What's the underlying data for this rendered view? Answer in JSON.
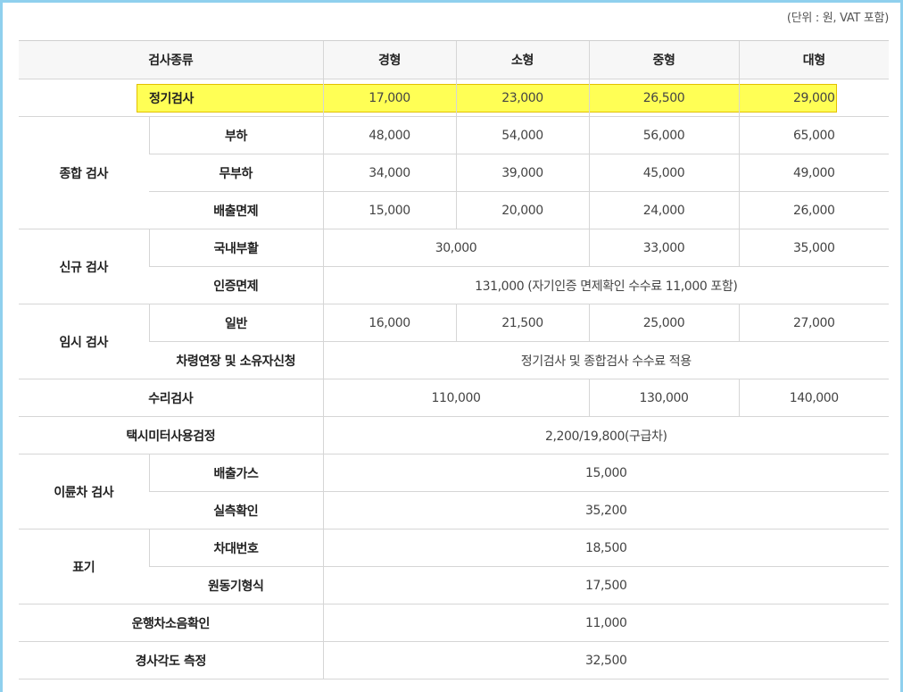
{
  "unit_note": "(단위 : 원, VAT 포함)",
  "header": {
    "type": "검사종류",
    "col1": "경형",
    "col2": "소형",
    "col3": "중형",
    "col4": "대형"
  },
  "regular": {
    "label": "정기검사",
    "values": [
      "17,000",
      "23,000",
      "26,500",
      "29,000"
    ]
  },
  "comprehensive": {
    "label": "종합 검사",
    "rows": [
      {
        "label": "부하",
        "values": [
          "48,000",
          "54,000",
          "56,000",
          "65,000"
        ]
      },
      {
        "label": "무부하",
        "values": [
          "34,000",
          "39,000",
          "45,000",
          "49,000"
        ]
      },
      {
        "label": "배출면제",
        "values": [
          "15,000",
          "20,000",
          "24,000",
          "26,000"
        ]
      }
    ]
  },
  "new_inspection": {
    "label": "신규 검사",
    "domestic": {
      "label": "국내부활",
      "small": "30,000",
      "mid": "33,000",
      "large": "35,000"
    },
    "cert": {
      "label": "인증면제",
      "value": "131,000 (자기인증 면제확인 수수료 11,000 포함)"
    }
  },
  "temporary": {
    "label": "임시 검사",
    "general": {
      "label": "일반",
      "values": [
        "16,000",
        "21,500",
        "25,000",
        "27,000"
      ]
    },
    "extension": {
      "label": "차령연장 및 소유자신청",
      "value": "정기검사 및 종합검사 수수료 적용"
    }
  },
  "repair": {
    "label": "수리검사",
    "small": "110,000",
    "mid": "130,000",
    "large": "140,000"
  },
  "taxi_meter": {
    "label": "택시미터사용검정",
    "value": "2,200/19,800(구급차)"
  },
  "two_wheel": {
    "label": "이륜차 검사",
    "rows": [
      {
        "label": "배출가스",
        "value": "15,000"
      },
      {
        "label": "실측확인",
        "value": "35,200"
      }
    ]
  },
  "marking": {
    "label": "표기",
    "rows": [
      {
        "label": "차대번호",
        "value": "18,500"
      },
      {
        "label": "원동기형식",
        "value": "17,500"
      }
    ]
  },
  "noise": {
    "label": "운행차소음확인",
    "value": "11,000"
  },
  "slope": {
    "label": "경사각도 측정",
    "value": "32,500"
  },
  "colors": {
    "highlight": "#ffff55",
    "frame": "#8fd0ee",
    "header_bg": "#f7f7f7",
    "border": "#d6d6d6"
  }
}
